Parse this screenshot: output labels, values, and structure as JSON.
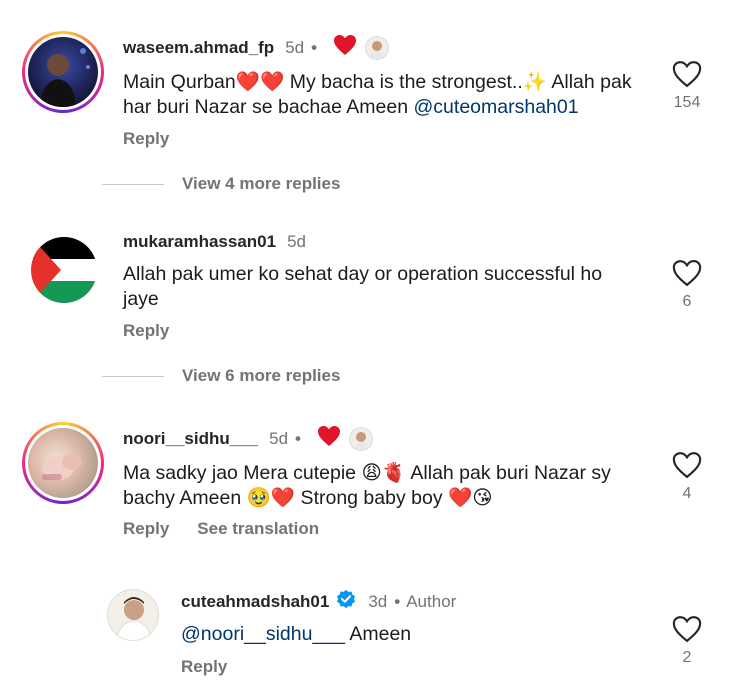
{
  "comments": [
    {
      "username": "waseem.ahmad_fp",
      "time": "5d",
      "dot": "•",
      "text": "Main Qurban❤️❤️ My bacha is the strongest..✨ Allah pak har buri Nazar se bachae Ameen",
      "mention": "@cuteomarshah01",
      "reply_label": "Reply",
      "like_count": "154",
      "view_more": "View 4 more replies"
    },
    {
      "username": "mukaramhassan01",
      "time": "5d",
      "text": "Allah pak umer ko sehat day or operation successful ho jaye",
      "reply_label": "Reply",
      "like_count": "6",
      "view_more": "View 6 more replies"
    },
    {
      "username": "noori__sidhu___",
      "time": "5d",
      "dot": "•",
      "text": "Ma sadky jao Mera cutepie 😩🫀 Allah pak buri Nazar sy bachy Ameen 🥹❤️ Strong baby boy ❤️😘",
      "reply_label": "Reply",
      "translate_label": "See translation",
      "like_count": "4"
    },
    {
      "username": "cuteahmadshah01",
      "time": "3d",
      "dot": "•",
      "author_label": "Author",
      "mention": "@noori__sidhu___",
      "text": "Ameen",
      "reply_label": "Reply",
      "like_count": "2"
    }
  ],
  "colors": {
    "heart_red": "#e0142b",
    "link": "#00376b",
    "muted": "#737373",
    "verified": "#0095f6"
  },
  "icons": [
    "heart-outline-icon",
    "heart-filled-icon",
    "verified-badge-icon"
  ]
}
